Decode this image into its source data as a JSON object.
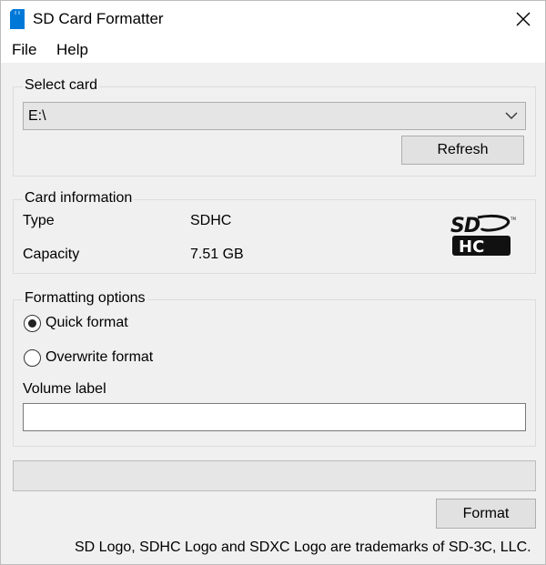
{
  "window": {
    "title": "SD Card Formatter",
    "close_icon": "close-icon",
    "app_icon": "sd-card-icon"
  },
  "menu": {
    "items": [
      {
        "label": "File"
      },
      {
        "label": "Help"
      }
    ]
  },
  "select_card": {
    "legend": "Select card",
    "selected_value": "E:\\",
    "refresh_label": "Refresh"
  },
  "card_information": {
    "legend": "Card information",
    "type_label": "Type",
    "type_value": "SDHC",
    "capacity_label": "Capacity",
    "capacity_value": "7.51 GB",
    "logo_icon": "sdhc-logo-icon"
  },
  "formatting_options": {
    "legend": "Formatting options",
    "quick_format_label": "Quick format",
    "quick_format_selected": true,
    "overwrite_format_label": "Overwrite format",
    "overwrite_format_selected": false,
    "volume_label_caption": "Volume label",
    "volume_label_value": ""
  },
  "progress": {
    "value_percent": 0
  },
  "actions": {
    "format_label": "Format"
  },
  "footer": {
    "trademark_notice": "SD Logo, SDHC Logo and SDXC Logo are trademarks of SD-3C, LLC."
  },
  "colors": {
    "accent": "#0078d7",
    "window_background": "#f0f0f0"
  }
}
